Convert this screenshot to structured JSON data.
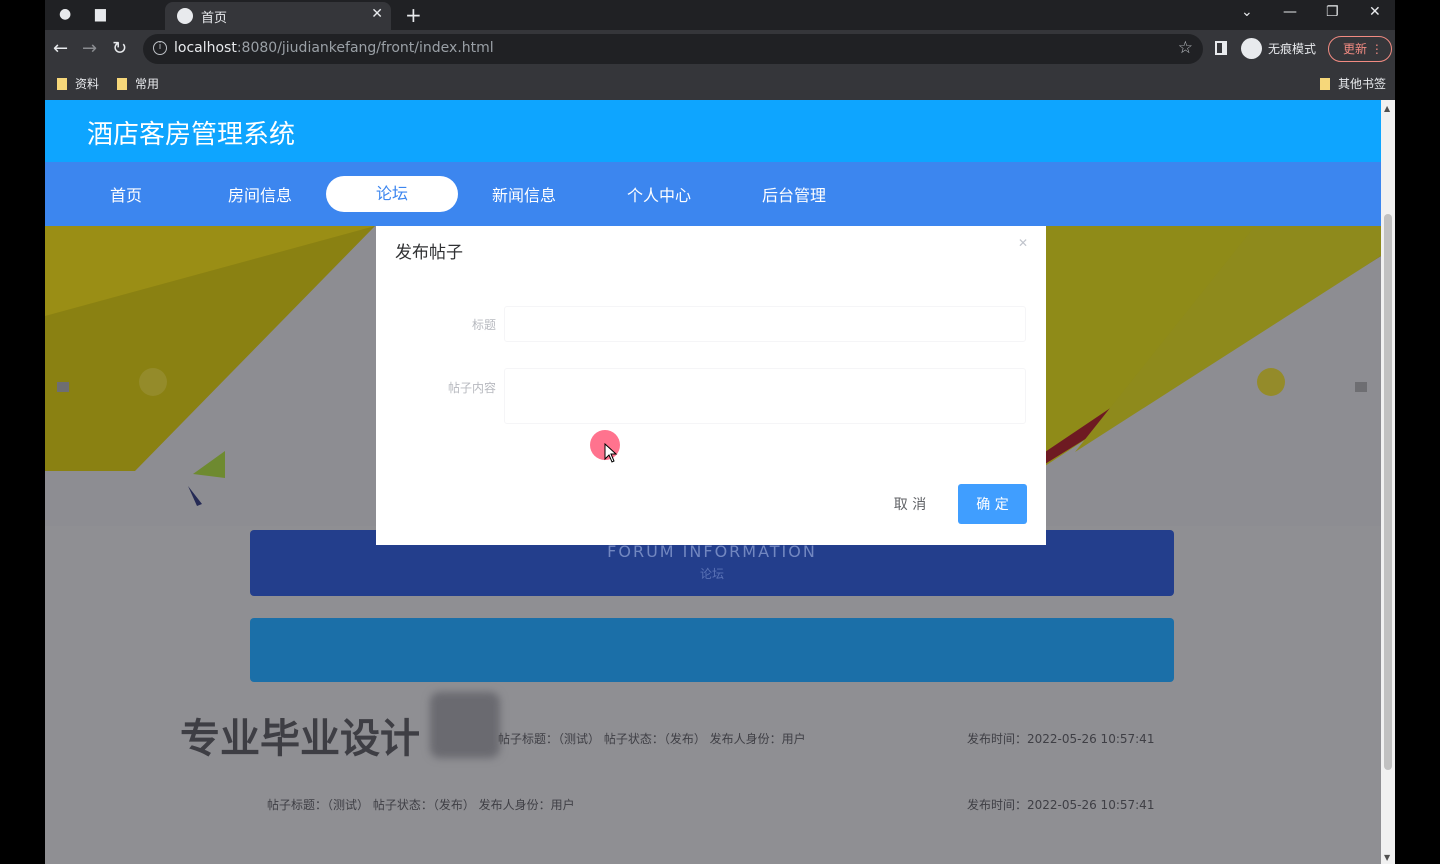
{
  "browser": {
    "tab_title": "首页",
    "url_host": "localhost",
    "url_rest": ":8080/jiudiankefang/front/index.html",
    "incognito_label": "无痕模式",
    "update_label": "更新",
    "bookmarks": [
      "资料",
      "常用"
    ],
    "other_bookmarks": "其他书签"
  },
  "site": {
    "title": "酒店客房管理系统",
    "nav": [
      "首页",
      "房间信息",
      "论坛",
      "新闻信息",
      "个人中心",
      "后台管理"
    ],
    "active_nav": "论坛"
  },
  "forum": {
    "heading_en": "FORUM  INFORMATION",
    "heading_cn": "论坛",
    "posts": [
      {
        "meta_left": "帖子标题：（测试）  帖子状态：（发布）  发布人身份：用户",
        "meta_right": "发布时间：2022-05-26 10:57:41"
      },
      {
        "meta_left": "帖子标题：（测试）  帖子状态：（发布）  发布人身份：用户",
        "meta_right": "发布时间：2022-05-26 10:57:41"
      }
    ],
    "watermark": "专业毕业设计"
  },
  "dialog": {
    "title": "发布帖子",
    "title_label": "标题",
    "content_label": "帖子内容",
    "cancel": "取 消",
    "confirm": "确 定"
  },
  "colors": {
    "header": "#0ea5ff",
    "nav": "#3c86ef",
    "primary_button": "#409eff"
  }
}
